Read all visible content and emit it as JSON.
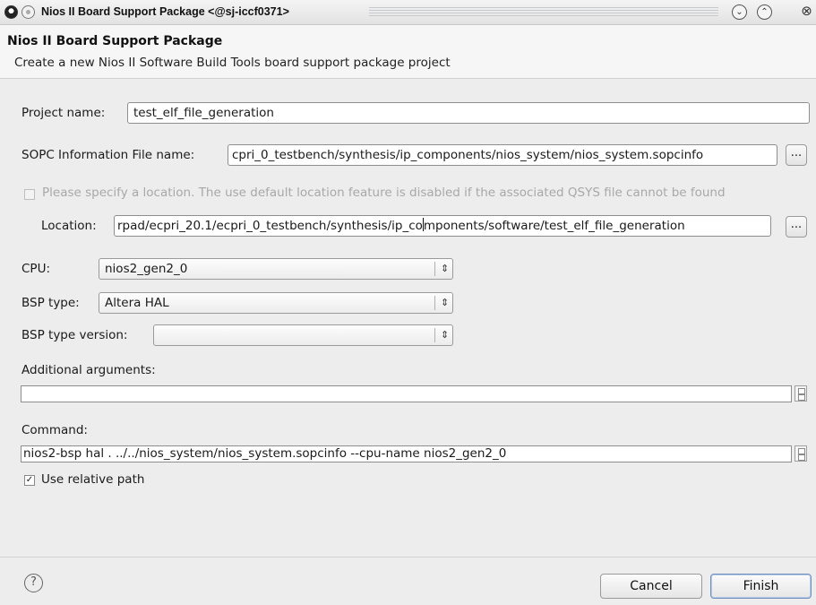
{
  "window": {
    "title": "Nios II Board Support Package  <@sj-iccf0371>"
  },
  "header": {
    "title": "Nios II Board Support Package",
    "description": "Create a new Nios II Software Build Tools board support package project"
  },
  "form": {
    "project_name_label": "Project name:",
    "project_name_value": "test_elf_file_generation",
    "sopc_label": "SOPC Information File name:",
    "sopc_value": "cpri_0_testbench/synthesis/ip_components/nios_system/nios_system.sopcinfo",
    "browse_label": "...",
    "location_checkbox_label": "Please specify a location.  The use default location feature is disabled if the associated QSYS file cannot be found",
    "location_label": "Location:",
    "location_value_a": "rpad/ecpri_20.1/ecpri_0_testbench/synthesis/ip_co",
    "location_value_b": "mponents/software/test_elf_file_generation",
    "cpu_label": "CPU:",
    "cpu_value": "nios2_gen2_0",
    "bsp_type_label": "BSP type:",
    "bsp_type_value": "Altera HAL",
    "bsp_version_label": "BSP type version:",
    "bsp_version_value": "",
    "additional_args_label": "Additional arguments:",
    "additional_args_value": "",
    "command_label": "Command:",
    "command_value": "nios2-bsp hal . ../../nios_system/nios_system.sopcinfo --cpu-name nios2_gen2_0",
    "relative_path_label": "Use relative path",
    "relative_path_checked": true
  },
  "footer": {
    "help_glyph": "?",
    "cancel_label": "Cancel",
    "finish_label": "Finish"
  },
  "icons": {
    "combo_arrow": "⇕",
    "checkmark": "✓"
  }
}
